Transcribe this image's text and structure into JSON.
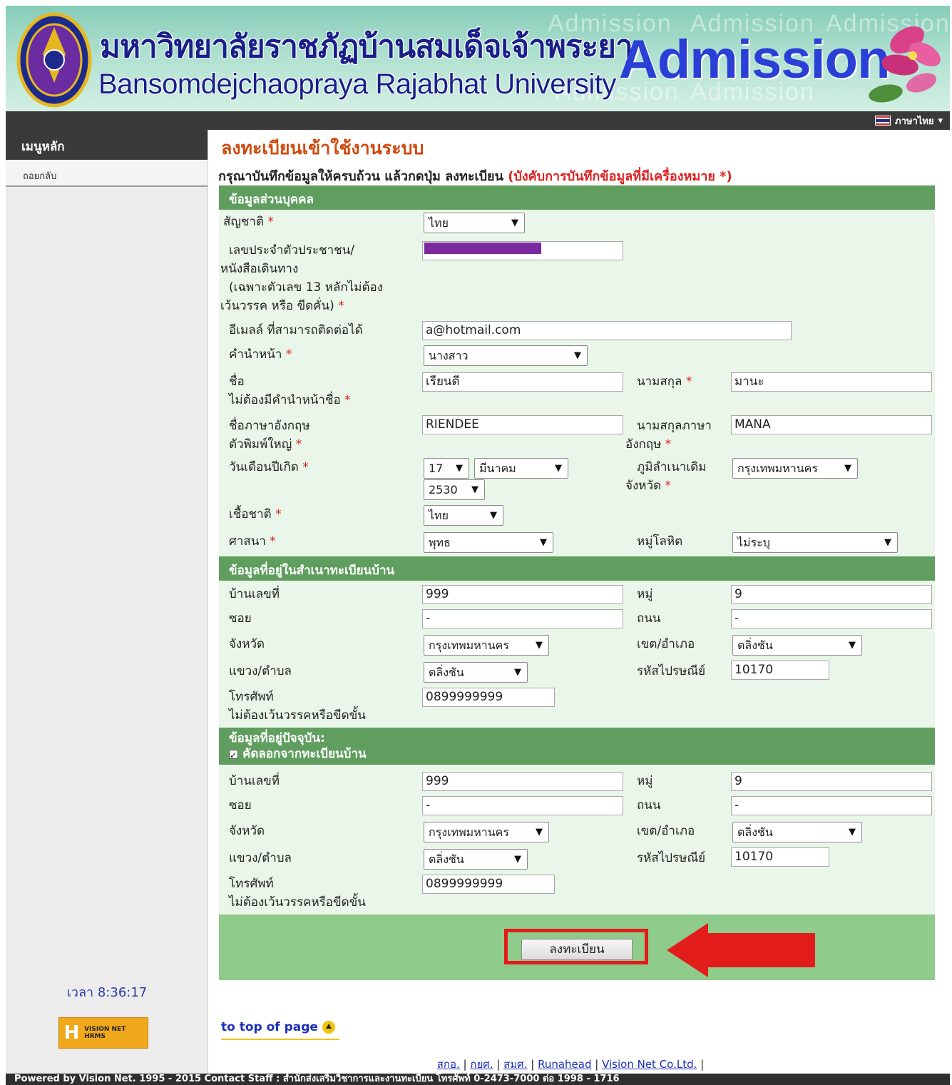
{
  "header": {
    "thai_name": "มหาวิทยาลัยราชภัฏบ้านสมเด็จเจ้าพระยา",
    "eng_name": "Bansomdejchaopraya Rajabhat University",
    "admission": "Admission",
    "watermark_word": "Admission"
  },
  "topbar": {
    "language": "ภาษาไทย"
  },
  "sidebar": {
    "menu_title": "เมนูหลัก",
    "logout": "ถอยกลับ",
    "clock": "เวลา 8:36:17",
    "vision_logo_text": "VISION NET HRMS"
  },
  "main": {
    "title": "ลงทะเบียนเข้าใช้งานระบบ",
    "instructions": "กรุณาบันทึกข้อมูลให้ครบถ้วน แล้วกดปุ่ม ลงทะเบียน",
    "instructions_req": "(บังคับการบันทึกข้อมูลที่มีเครื่องหมาย *)"
  },
  "personal": {
    "heading": "ข้อมูลส่วนบุคคล",
    "nationality": {
      "label": "สัญชาติ",
      "value": "ไทย"
    },
    "id_card": {
      "label_lines": [
        "เลขประจำตัวประชาชน/",
        "หนังสือเดินทาง",
        "(เฉพาะตัวเลข 13 หลักไม่ต้อง",
        "เว้นวรรค หรือ ขีดคั่น)"
      ],
      "value": ""
    },
    "email": {
      "label": "อีเมลล์ ที่สามารถติดต่อได้",
      "value": "a@hotmail.com"
    },
    "prefix": {
      "label": "คำนำหน้า",
      "value": "นางสาว"
    },
    "first_name": {
      "label_lines": [
        "ชื่อ",
        "ไม่ต้องมีคำนำหน้าชื่อ"
      ],
      "value": "เรียนดี"
    },
    "last_name": {
      "label": "นามสกุล",
      "value": "มานะ"
    },
    "first_name_en": {
      "label_lines": [
        "ชื่อภาษาอังกฤษ",
        "ตัวพิมพ์ใหญ่"
      ],
      "value": "RIENDEE"
    },
    "last_name_en": {
      "label_lines": [
        "นามสกุลภาษา",
        "อังกฤษ"
      ],
      "value": "MANA"
    },
    "birthdate": {
      "label": "วันเดือนปีเกิด",
      "day": "17",
      "month": "มีนาคม",
      "year": "2530"
    },
    "birth_province": {
      "label_lines": [
        "ภูมิลำเนาเดิม",
        "จังหวัด"
      ],
      "value": "กรุงเทพมหานคร"
    },
    "ethnicity": {
      "label": "เชื้อชาติ",
      "value": "ไทย"
    },
    "religion": {
      "label": "ศาสนา",
      "value": "พุทธ"
    },
    "blood_group": {
      "label": "หมู่โลหิต",
      "value": "ไม่ระบุ"
    }
  },
  "registered_address": {
    "heading": "ข้อมูลที่อยู่ในสำเนาทะเบียนบ้าน",
    "house_no": {
      "label": "บ้านเลขที่",
      "value": "999"
    },
    "moo": {
      "label": "หมู่",
      "value": "9"
    },
    "soi": {
      "label": "ซอย",
      "value": "-"
    },
    "road": {
      "label": "ถนน",
      "value": "-"
    },
    "province": {
      "label": "จังหวัด",
      "value": "กรุงเทพมหานคร"
    },
    "district": {
      "label": "เขต/อำเภอ",
      "value": "ตลิ่งชัน"
    },
    "subdistrict": {
      "label": "แขวง/ตำบล",
      "value": "ตลิ่งชัน"
    },
    "postcode": {
      "label": "รหัสไปรษณีย์",
      "value": "10170"
    },
    "phone": {
      "label_lines": [
        "โทรศัพท์",
        "ไม่ต้องเว้นวรรคหรือขีดขั้น"
      ],
      "value": "0899999999"
    }
  },
  "current_address": {
    "heading": "ข้อมูลที่อยู่ปัจจุบัน:",
    "copy_label": "คัดลอกจากทะเบียนบ้าน",
    "house_no": {
      "label": "บ้านเลขที่",
      "value": "999"
    },
    "moo": {
      "label": "หมู่",
      "value": "9"
    },
    "soi": {
      "label": "ซอย",
      "value": "-"
    },
    "road": {
      "label": "ถนน",
      "value": "-"
    },
    "province": {
      "label": "จังหวัด",
      "value": "กรุงเทพมหานคร"
    },
    "district": {
      "label": "เขต/อำเภอ",
      "value": "ตลิ่งชัน"
    },
    "subdistrict": {
      "label": "แขวง/ตำบล",
      "value": "ตลิ่งชัน"
    },
    "postcode": {
      "label": "รหัสไปรษณีย์",
      "value": "10170"
    },
    "phone": {
      "label_lines": [
        "โทรศัพท์",
        "ไม่ต้องเว้นวรรคหรือขีดขั้น"
      ],
      "value": "0899999999"
    }
  },
  "submit": {
    "label": "ลงทะเบียน"
  },
  "to_top": "to top of page",
  "footer_links": [
    "สกอ.",
    "กยศ.",
    "สมศ.",
    "Runahead",
    "Vision Net Co.Ltd."
  ],
  "bottom_bar": "Powered by Vision Net. 1995 - 2015    Contact Staff : สำนักส่งเสริมวิชาการและงานทะเบียน โทรศัพท์ 0-2473-7000 ต่อ 1998 - 1716",
  "colors": {
    "section_header": "#5f9e5e",
    "form_bg": "#e9f6e9",
    "title": "#d04a0f",
    "highlight": "#e21b1b"
  }
}
